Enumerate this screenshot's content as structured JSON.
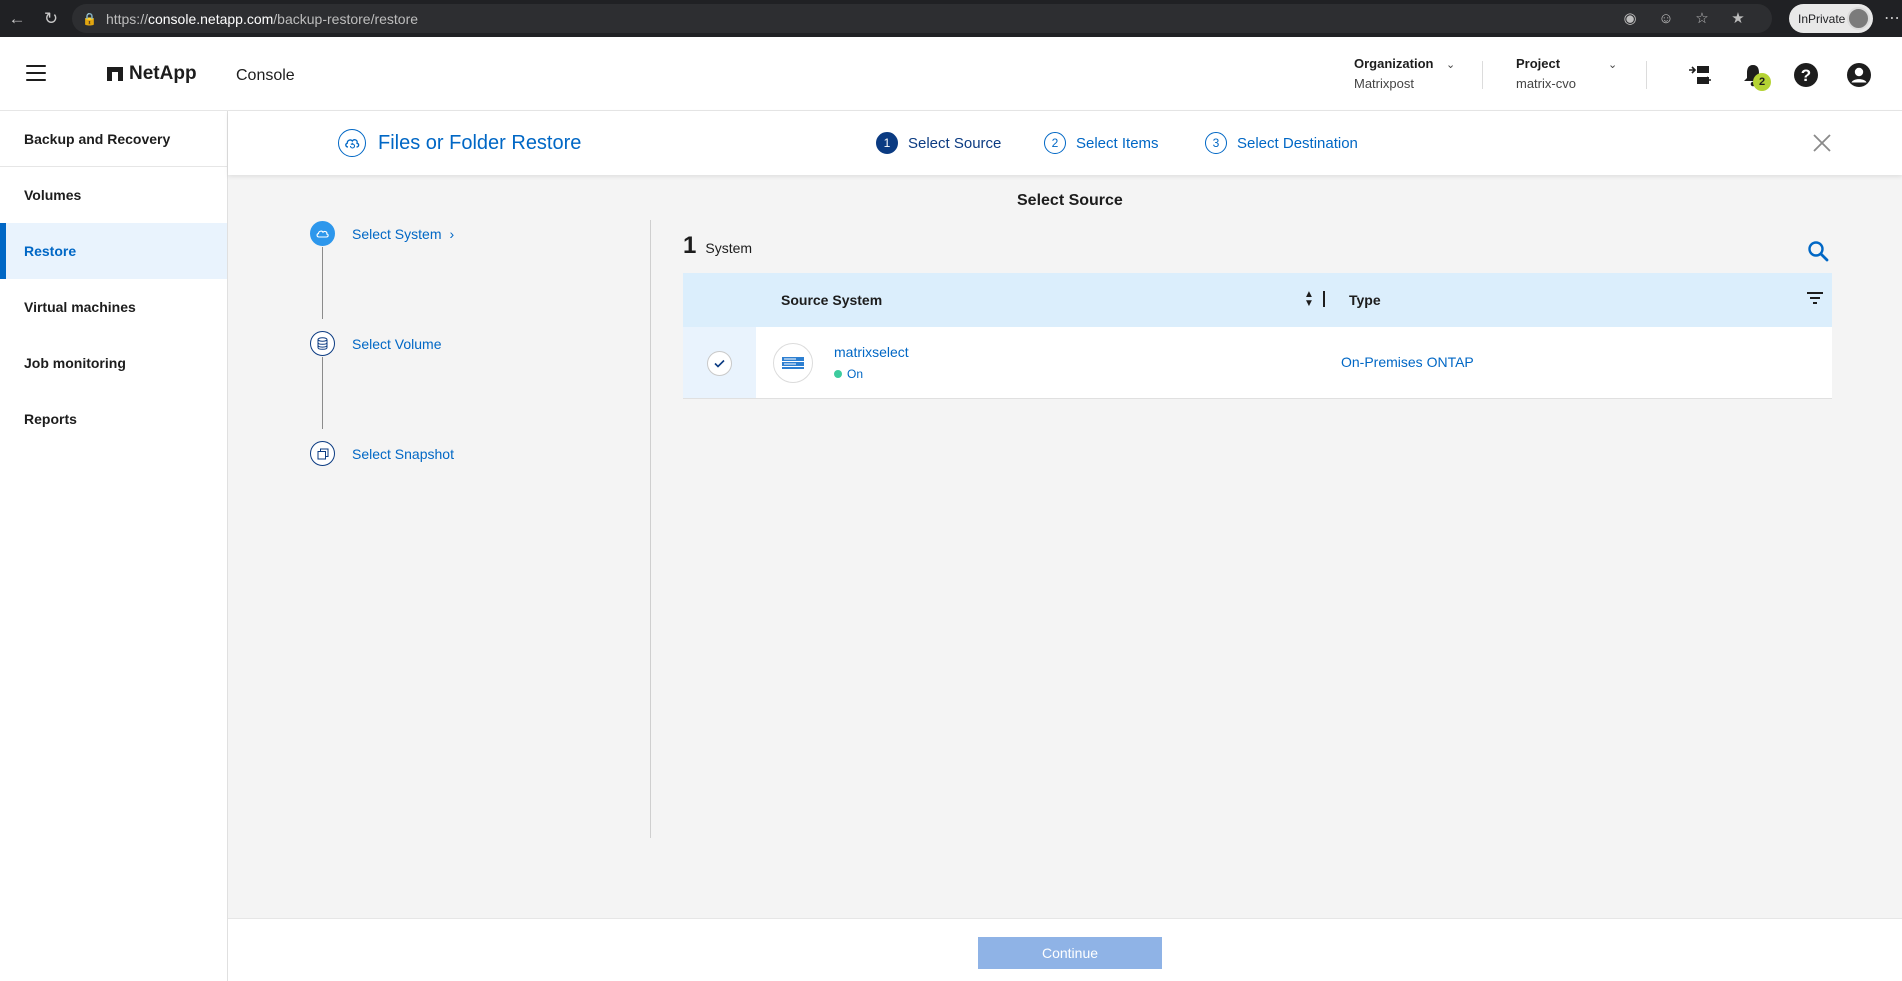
{
  "browser": {
    "url_prefix": "https://",
    "url_host": "console.netapp.com",
    "url_path": "/backup-restore/restore",
    "inprivate_label": "InPrivate"
  },
  "header": {
    "brand": "NetApp",
    "console_label": "Console",
    "organization_label": "Organization",
    "organization_value": "Matrixpost",
    "project_label": "Project",
    "project_value": "matrix-cvo",
    "notification_count": "2"
  },
  "sidebar": {
    "title": "Backup and Recovery",
    "items": [
      {
        "label": "Volumes"
      },
      {
        "label": "Restore"
      },
      {
        "label": "Virtual machines"
      },
      {
        "label": "Job monitoring"
      },
      {
        "label": "Reports"
      }
    ]
  },
  "wizard": {
    "title": "Files or Folder Restore",
    "steps": [
      {
        "num": "1",
        "label": "Select Source"
      },
      {
        "num": "2",
        "label": "Select Items"
      },
      {
        "num": "3",
        "label": "Select Destination"
      }
    ]
  },
  "content": {
    "title": "Select Source",
    "sub_steps": [
      {
        "label": "Select System"
      },
      {
        "label": "Select Volume"
      },
      {
        "label": "Select Snapshot"
      }
    ],
    "count_number": "1",
    "count_label": "System",
    "table": {
      "columns": [
        "Source System",
        "Type"
      ],
      "rows": [
        {
          "name": "matrixselect",
          "status": "On",
          "type": "On-Premises ONTAP"
        }
      ]
    }
  },
  "footer": {
    "continue_label": "Continue"
  }
}
